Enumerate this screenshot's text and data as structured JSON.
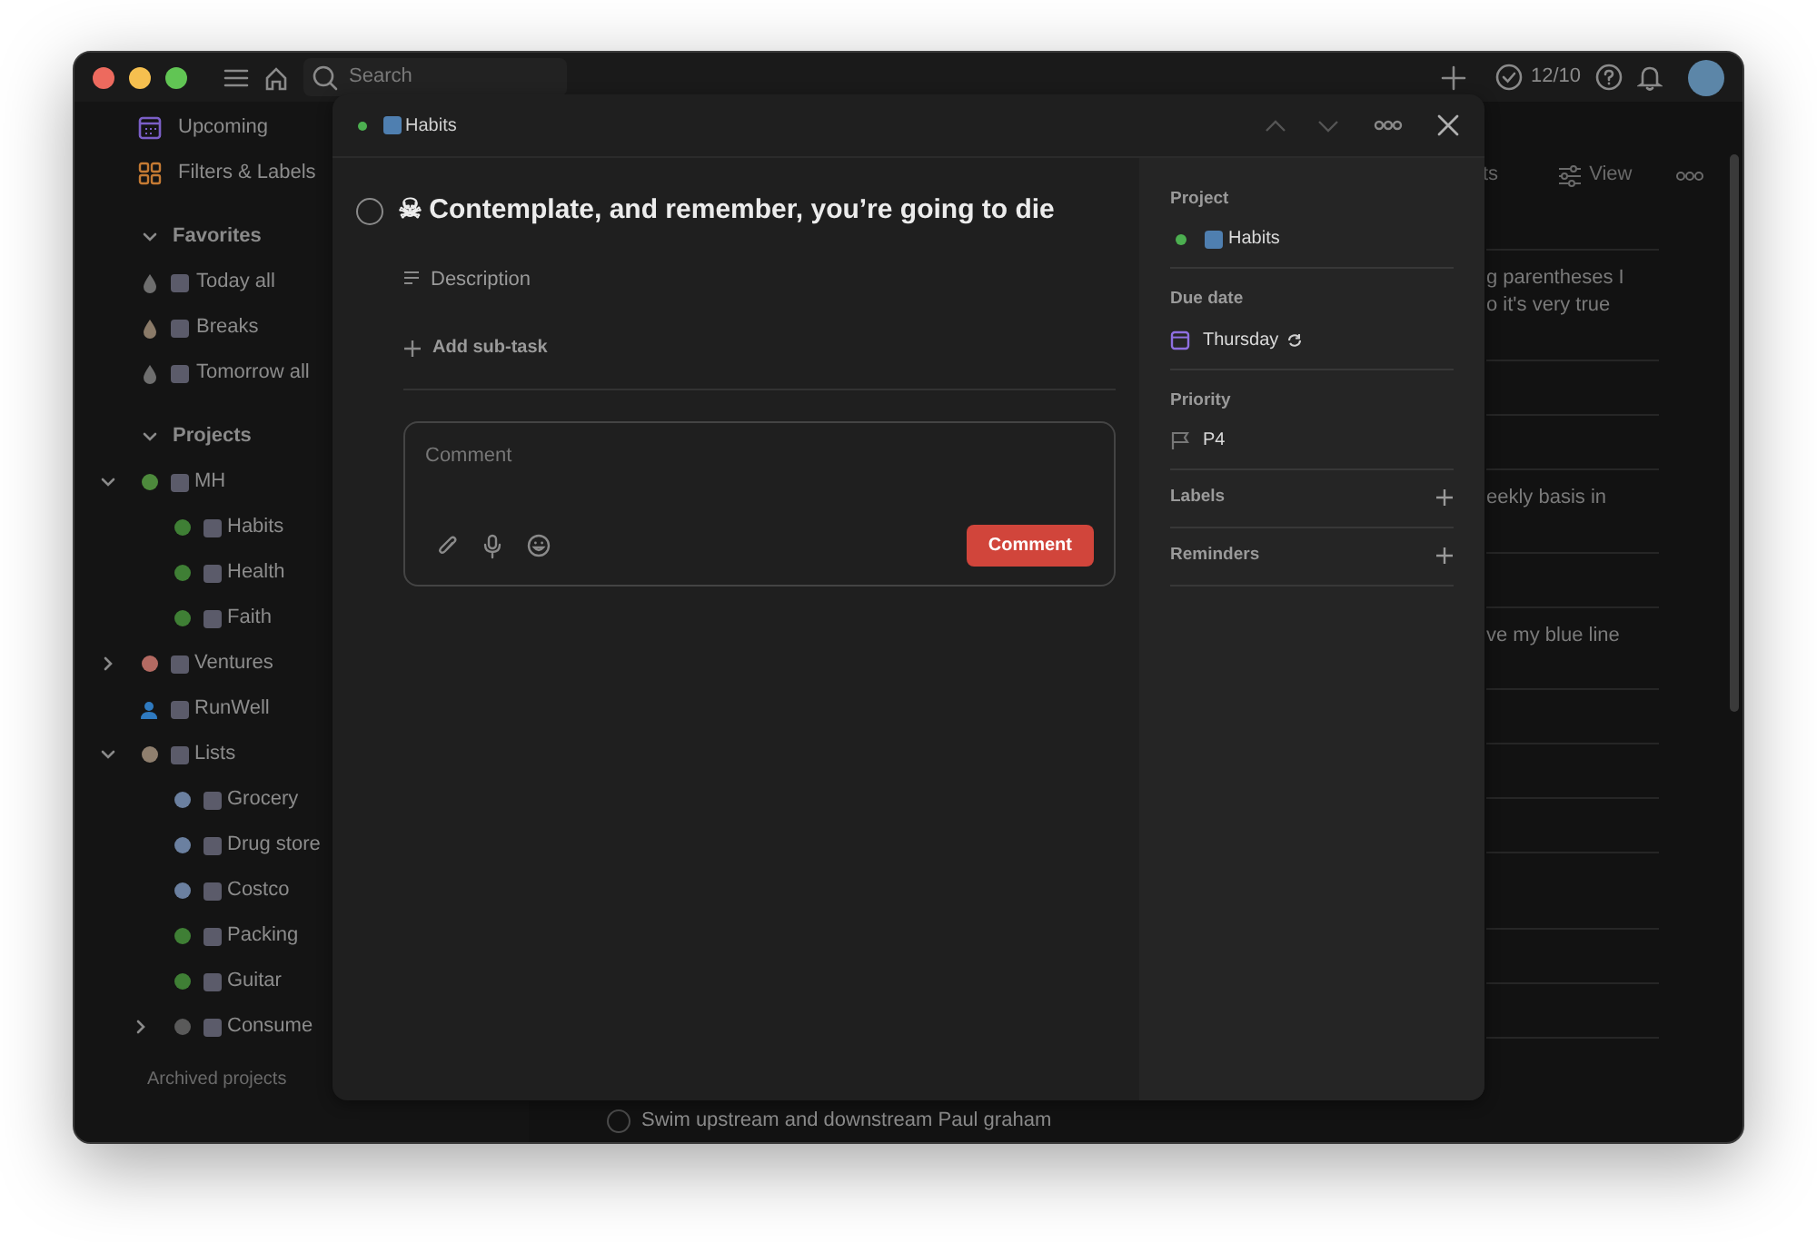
{
  "toolbar": {
    "search": {
      "placeholder": "Search"
    },
    "completed_count": "12/10"
  },
  "sidebar": {
    "nav": [
      {
        "kind": "upcoming",
        "label": "Upcoming"
      },
      {
        "kind": "filters",
        "label": "Filters & Labels"
      }
    ],
    "favorites": {
      "title": "Favorites",
      "expanded": true,
      "items": [
        {
          "label": "Today all",
          "color": "#6e6e6e"
        },
        {
          "label": "Breaks",
          "color": "#8a7a68"
        },
        {
          "label": "Tomorrow all",
          "color": "#6e6e6e"
        }
      ]
    },
    "projects": {
      "title": "Projects",
      "expanded": true,
      "items": [
        {
          "label": "MH",
          "kind": "dot",
          "color": "#4d8a3c",
          "expanded": true,
          "children": [
            {
              "label": "Habits",
              "kind": "dot",
              "color": "#3f7f35"
            },
            {
              "label": "Health",
              "kind": "dot",
              "color": "#3f7f35"
            },
            {
              "label": "Faith",
              "kind": "dot",
              "color": "#3f7f35"
            }
          ]
        },
        {
          "label": "Ventures",
          "kind": "dot",
          "color": "#b46a62",
          "expanded": false
        },
        {
          "label": "RunWell",
          "kind": "person",
          "color": "#2f7ac0"
        },
        {
          "label": "Lists",
          "kind": "dot",
          "color": "#8f7f6e",
          "expanded": true,
          "children": [
            {
              "label": "Grocery",
              "kind": "dot",
              "color": "#6b80a0"
            },
            {
              "label": "Drug store",
              "kind": "dot",
              "color": "#6b80a0"
            },
            {
              "label": "Costco",
              "kind": "dot",
              "color": "#6b80a0"
            },
            {
              "label": "Packing",
              "kind": "dot",
              "color": "#3f7f35"
            },
            {
              "label": "Guitar",
              "kind": "dot",
              "color": "#3f7f35"
            },
            {
              "label": "Consume",
              "kind": "dot",
              "color": "#5a5a5a",
              "expanded": false
            }
          ]
        }
      ]
    },
    "archived": "Archived projects"
  },
  "main": {
    "header": {
      "partial_label": "ts",
      "view_label": "View"
    },
    "rows": [
      {
        "lines": [
          "g parentheses I",
          "o it's very true"
        ]
      },
      {
        "lines": []
      },
      {
        "lines": []
      },
      {
        "lines": [
          "eekly basis in"
        ]
      },
      {
        "lines": []
      },
      {
        "lines": [
          "ve my blue line"
        ]
      },
      {
        "lines": []
      },
      {
        "lines": []
      },
      {
        "lines": []
      },
      {
        "lines": []
      },
      {
        "lines": []
      },
      {
        "lines": []
      },
      {
        "lines": []
      }
    ],
    "footer_task": {
      "title": "Swim upstream and downstream Paul graham",
      "completed": false
    }
  },
  "task_modal": {
    "breadcrumb": {
      "project": "Habits",
      "color": "#4caf50"
    },
    "task": {
      "title": "☠ Contemplate, and remember, you’re going to die",
      "completed": false
    },
    "description_placeholder": "Description",
    "add_subtask": "Add sub-task",
    "comment": {
      "placeholder": "Comment",
      "button": "Comment"
    },
    "details": [
      {
        "kind": "project",
        "label": "Project",
        "value": "Habits",
        "color": "#4caf50"
      },
      {
        "kind": "date",
        "label": "Due date",
        "value": "Thursday",
        "recurring": true
      },
      {
        "kind": "priority",
        "label": "Priority",
        "value": "P4"
      },
      {
        "kind": "add",
        "label": "Labels"
      },
      {
        "kind": "add",
        "label": "Reminders"
      }
    ]
  }
}
